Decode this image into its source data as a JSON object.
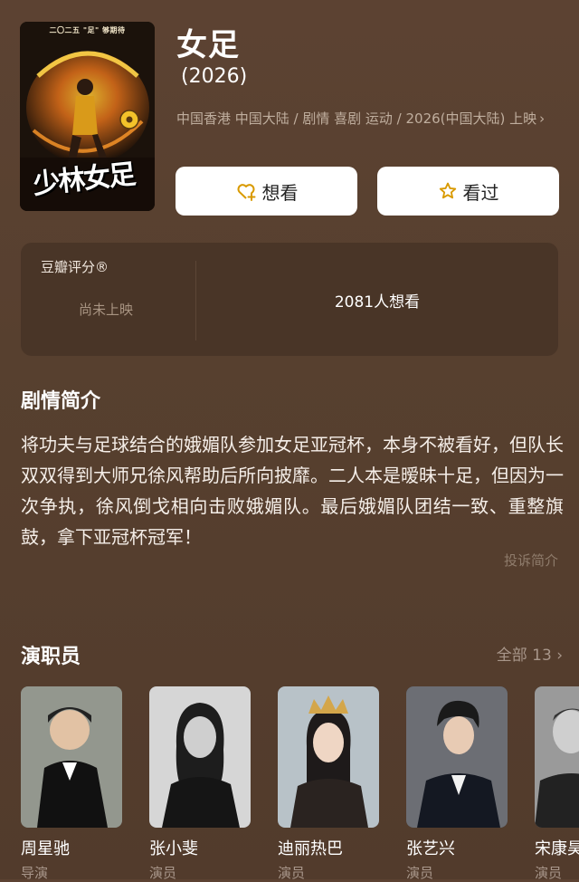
{
  "movie": {
    "poster_caption": "二〇二五 \"足\" 够期待",
    "poster_art_text": "少林女足",
    "title": "女足",
    "year": "(2026)",
    "meta_line": "中国香港 中国大陆 / 剧情 喜剧 运动 / 2026(中国大陆) 上映",
    "chevron": "›"
  },
  "actions": {
    "want_label": "想看",
    "seen_label": "看过"
  },
  "rating": {
    "label": "豆瓣评分®",
    "status": "尚未上映",
    "want_count": "2081人想看"
  },
  "synopsis": {
    "title": "剧情简介",
    "text": "将功夫与足球结合的娥媚队参加女足亚冠杯，本身不被看好，但队长双双得到大师兄徐风帮助后所向披靡。二人本是暧昧十足，但因为一次争执，徐风倒戈相向击败娥媚队。最后娥媚队团结一致、重整旗鼓，拿下亚冠杯冠军！",
    "report": "投诉简介"
  },
  "cast": {
    "title": "演职员",
    "all_label": "全部 13 ›",
    "members": [
      {
        "name": "周星驰",
        "role": "导演"
      },
      {
        "name": "张小斐",
        "role": "演员"
      },
      {
        "name": "迪丽热巴",
        "role": "演员"
      },
      {
        "name": "张艺兴",
        "role": "演员"
      },
      {
        "name": "宋康昊",
        "role": "演员"
      }
    ]
  },
  "colors": {
    "background": "#57402f",
    "card": "#493527",
    "muted_text": "#a8968a",
    "star_icon": "#d99a00"
  }
}
